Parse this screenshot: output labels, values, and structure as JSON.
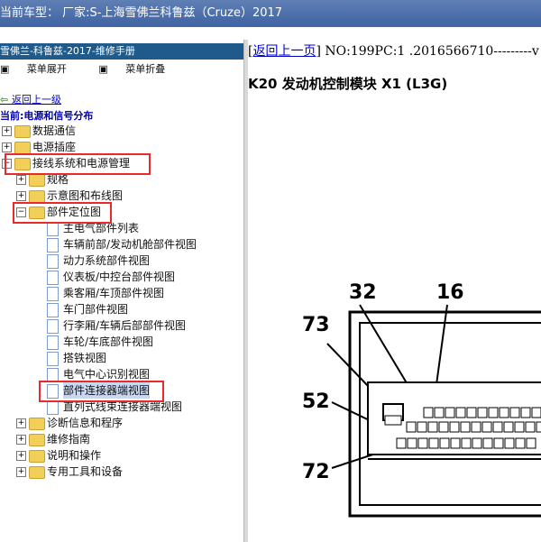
{
  "window": {
    "title": "当前车型： 厂家:S-上海雪佛兰科鲁兹（Cruze）2017"
  },
  "sidebar": {
    "header": "雪佛兰-科鲁兹-2017-维修手册",
    "toolbar": {
      "expand": "菜单展开",
      "collapse": "菜单折叠"
    },
    "back_link": "返回上一级",
    "current": "当前:电源和信号分布",
    "tree": [
      {
        "label": "数据通信",
        "expanded": false
      },
      {
        "label": "电源插座",
        "expanded": false
      },
      {
        "label": "接线系统和电源管理",
        "expanded": true
      },
      {
        "label": "规格",
        "expanded": false
      },
      {
        "label": "示意图和布线图",
        "expanded": false
      },
      {
        "label": "部件定位图",
        "expanded": true
      },
      {
        "label": "主电气部件列表"
      },
      {
        "label": "车辆前部/发动机舱部件视图"
      },
      {
        "label": "动力系统部件视图"
      },
      {
        "label": "仪表板/中控台部件视图"
      },
      {
        "label": "乘客厢/车顶部件视图"
      },
      {
        "label": "车门部件视图"
      },
      {
        "label": "行李厢/车辆后部部件视图"
      },
      {
        "label": "车轮/车底部件视图"
      },
      {
        "label": "搭铁视图"
      },
      {
        "label": "电气中心识别视图"
      },
      {
        "label": "部件连接器端视图",
        "selected": true
      },
      {
        "label": "直列式线束连接器端视图"
      },
      {
        "label": "诊断信息和程序",
        "expanded": false
      },
      {
        "label": "维修指南",
        "expanded": false
      },
      {
        "label": "说明和操作",
        "expanded": false
      },
      {
        "label": "专用工具和设备",
        "expanded": false
      }
    ]
  },
  "content": {
    "nav_back": "返回上一页",
    "doc_no": "NO:199PC:1 .2016566710---------v",
    "title": "K20 发动机控制模块 X1 (L3G)",
    "callouts": [
      "32",
      "16",
      "73",
      "52",
      "72"
    ]
  },
  "colors": {
    "titlebar": "#4f70ab",
    "header": "#1f5a8a",
    "highlight": "#ea2a2a",
    "link": "#0000cc"
  }
}
